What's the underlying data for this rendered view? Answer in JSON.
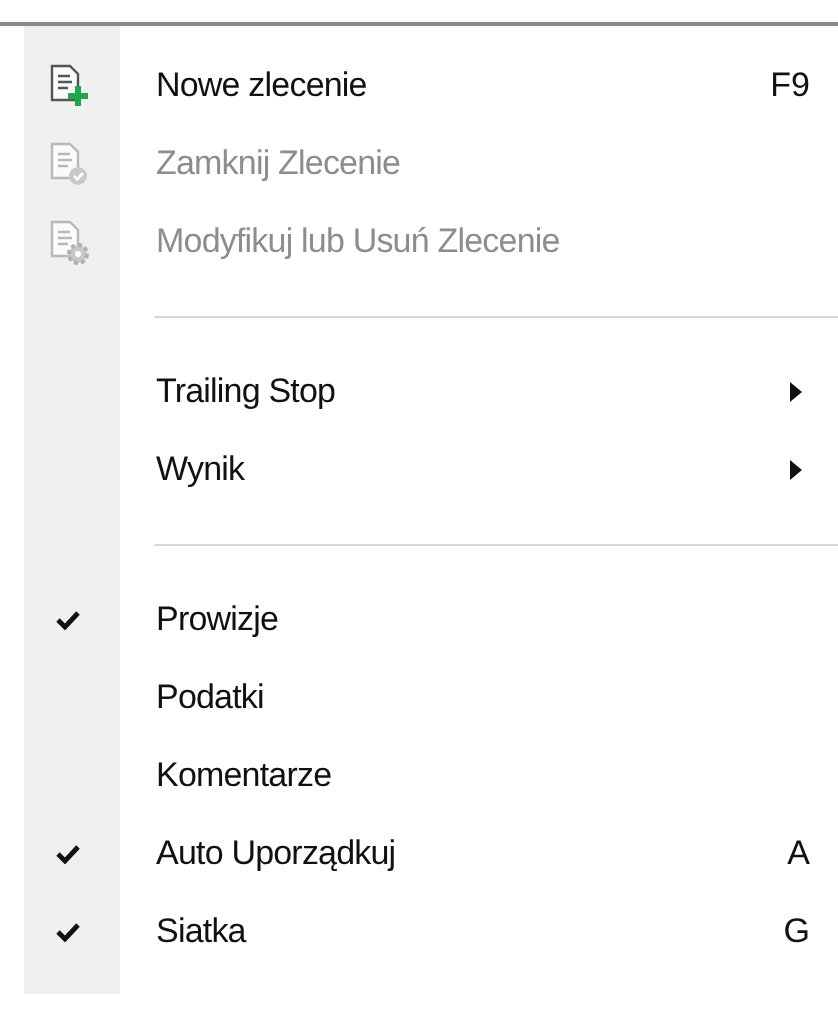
{
  "menu": {
    "items": [
      {
        "kind": "command",
        "label": "Nowe zlecenie",
        "shortcut": "F9",
        "disabled": false
      },
      {
        "kind": "command",
        "label": "Zamknij Zlecenie",
        "disabled": true
      },
      {
        "kind": "command",
        "label": "Modyfikuj lub Usuń Zlecenie",
        "disabled": true
      },
      {
        "kind": "separator"
      },
      {
        "kind": "submenu",
        "label": "Trailing Stop"
      },
      {
        "kind": "submenu",
        "label": "Wynik"
      },
      {
        "kind": "separator"
      },
      {
        "kind": "command",
        "label": "Prowizje",
        "disabled": false,
        "checked": true
      },
      {
        "kind": "command",
        "label": "Podatki",
        "disabled": false,
        "checked": false
      },
      {
        "kind": "command",
        "label": "Komentarze",
        "disabled": false,
        "checked": false
      },
      {
        "kind": "command",
        "label": "Auto Uporządkuj",
        "shortcut": "A",
        "disabled": false,
        "checked": true
      },
      {
        "kind": "command",
        "label": "Siatka",
        "shortcut": "G",
        "disabled": false,
        "checked": true
      }
    ]
  }
}
